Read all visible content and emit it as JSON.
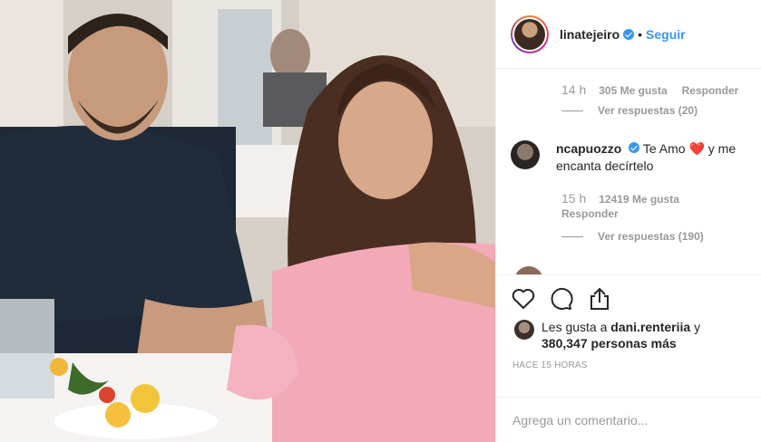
{
  "post": {
    "username": "linatejeiro",
    "follow_label": "Seguir",
    "separator": "•"
  },
  "comments": [
    {
      "time": "14 h",
      "likes": "305 Me gusta",
      "reply_label": "Responder",
      "view_replies": "Ver respuestas (20)"
    },
    {
      "username": "ncapuozzo",
      "text_before": "Te Amo",
      "heart": "❤️",
      "text_after": "y me encanta decírtelo",
      "time": "15 h",
      "likes": "12419 Me gusta",
      "reply_label": "Responder",
      "view_replies": "Ver respuestas (190)"
    }
  ],
  "likes": {
    "prefix": "Les gusta a",
    "user": "dani.renteriia",
    "joiner": "y",
    "others": "380,347 personas más"
  },
  "time_ago": "HACE 15 HORAS",
  "comment_input": {
    "placeholder": "Agrega un comentario..."
  },
  "icons": [
    "heart-icon",
    "comment-icon",
    "share-icon"
  ],
  "colors": {
    "link": "#3897f0",
    "muted": "#999999",
    "heart": "#e0245e"
  }
}
